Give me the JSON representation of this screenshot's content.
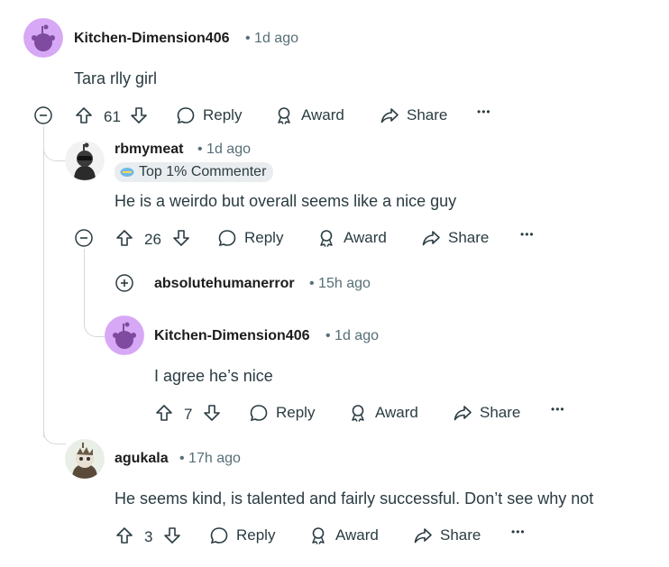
{
  "comments": [
    {
      "username": "Kitchen-Dimension406",
      "time": "1d ago",
      "text": "Tara rlly girl",
      "votes": "61"
    },
    {
      "username": "rbmymeat",
      "time": "1d ago",
      "flair": "Top 1% Commenter",
      "text": "He is a weirdo but overall seems like a nice guy",
      "votes": "26"
    },
    {
      "username": "absolutehumanerror",
      "time": "15h ago"
    },
    {
      "username": "Kitchen-Dimension406",
      "time": "1d ago",
      "text": "I agree he’s nice",
      "votes": "7"
    },
    {
      "username": "agukala",
      "time": "17h ago",
      "text": "He seems kind, is talented and fairly successful. Don’t see why not",
      "votes": "3"
    }
  ],
  "actions": {
    "reply": "Reply",
    "award": "Award",
    "share": "Share",
    "more": "•••"
  },
  "colors": {
    "avatar_purple": "#d7a8f5",
    "thread_line": "#d4d8dc",
    "meta_gray": "#576f76"
  }
}
